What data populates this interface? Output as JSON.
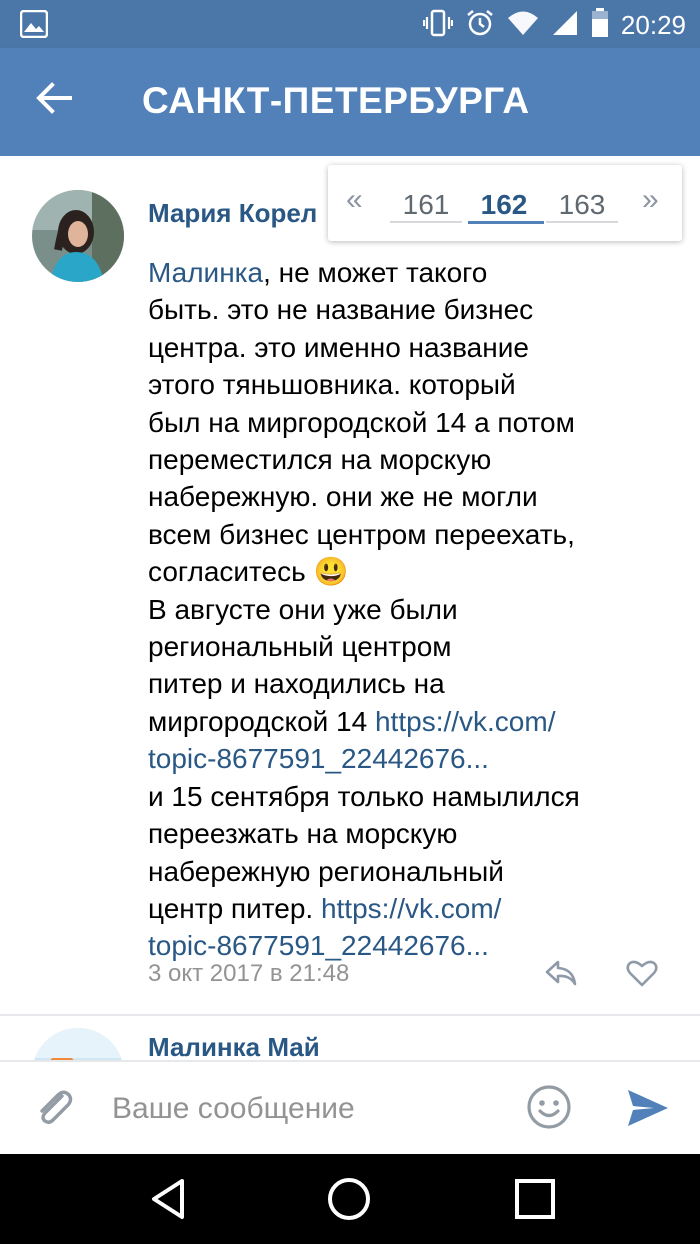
{
  "status_bar": {
    "time": "20:29",
    "icons": [
      "image-icon",
      "vibrate-icon",
      "alarm-icon",
      "wifi-icon",
      "signal-icon",
      "battery-icon"
    ]
  },
  "app_bar": {
    "title": "САНКТ-ПЕТЕРБУРГА",
    "back_icon": "arrow-left-icon"
  },
  "pager": {
    "prev": "«",
    "next": "»",
    "pages": [
      "161",
      "162",
      "163"
    ],
    "active": "162"
  },
  "posts": [
    {
      "author": "Мария Корел",
      "lines": [
        {
          "parts": [
            {
              "t": "Малинка",
              "link": true
            },
            {
              "t": ", не может такого"
            }
          ]
        },
        {
          "parts": [
            {
              "t": "быть. это не название бизнес"
            }
          ]
        },
        {
          "parts": [
            {
              "t": "центра. это именно название"
            }
          ]
        },
        {
          "parts": [
            {
              "t": "этого тяньшовника. который"
            }
          ]
        },
        {
          "parts": [
            {
              "t": "был на миргородской 14 а потом"
            }
          ]
        },
        {
          "parts": [
            {
              "t": "переместился на морскую"
            }
          ]
        },
        {
          "parts": [
            {
              "t": "набережную. они же не могли"
            }
          ]
        },
        {
          "parts": [
            {
              "t": "всем бизнес центром переехать,"
            }
          ]
        },
        {
          "parts": [
            {
              "t": "согласитесь "
            },
            {
              "t": "😃",
              "emoji": true
            }
          ]
        },
        {
          "parts": [
            {
              "t": "В августе они уже были"
            }
          ]
        },
        {
          "parts": [
            {
              "t": "региональный центром"
            }
          ]
        },
        {
          "parts": [
            {
              "t": "питер и находились на"
            }
          ]
        },
        {
          "parts": [
            {
              "t": "миргородской 14 "
            },
            {
              "t": "https://vk.com/",
              "link": true
            }
          ]
        },
        {
          "parts": [
            {
              "t": "topic-8677591_22442676...",
              "link": true
            }
          ]
        },
        {
          "parts": [
            {
              "t": "и 15 сентября только намылился"
            }
          ]
        },
        {
          "parts": [
            {
              "t": "переезжать на морскую"
            }
          ]
        },
        {
          "parts": [
            {
              "t": "набережную региональный"
            }
          ]
        },
        {
          "parts": [
            {
              "t": "центр питер. "
            },
            {
              "t": "https://vk.com/",
              "link": true
            }
          ]
        },
        {
          "parts": [
            {
              "t": "topic-8677591_22442676...",
              "link": true
            }
          ]
        }
      ],
      "date": "3 окт 2017 в 21:48"
    },
    {
      "author": "Малинка Май"
    }
  ],
  "composer": {
    "placeholder": "Ваше сообщение",
    "attach_icon": "paperclip-icon",
    "emoji_icon": "smile-icon",
    "send_icon": "send-icon"
  },
  "nav_bar": {
    "icons": [
      "back-triangle-icon",
      "home-circle-icon",
      "recents-square-icon"
    ]
  },
  "colors": {
    "header": "#5181b8",
    "status": "#4a76a8",
    "link": "#2a5885",
    "muted": "#939393"
  }
}
